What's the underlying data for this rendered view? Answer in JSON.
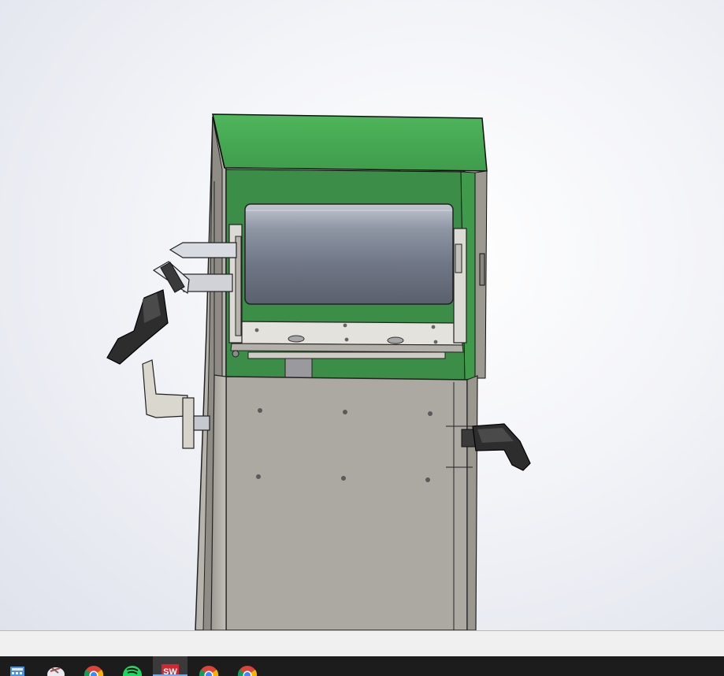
{
  "app": {
    "name": "SOLIDWORKS"
  },
  "viewport": {
    "model": "enclosure-assembly-with-roller-and-clamp-handles"
  },
  "taskbar": {
    "items": [
      {
        "icon": "calculator-icon",
        "active": false
      },
      {
        "icon": "snipping-tool-icon",
        "active": false
      },
      {
        "icon": "chrome-icon",
        "active": false
      },
      {
        "icon": "spotify-icon",
        "active": false
      },
      {
        "icon": "solidworks-icon",
        "label": "SW",
        "active": true
      },
      {
        "icon": "chrome-icon",
        "active": false
      },
      {
        "icon": "chrome-icon",
        "active": false
      }
    ]
  },
  "colors": {
    "enclosure_green": "#46a753",
    "panel_gray": "#aba8a0",
    "roller": "#7d8595",
    "handle": "#2b2b2b",
    "taskbar": "#1c1c1c"
  }
}
